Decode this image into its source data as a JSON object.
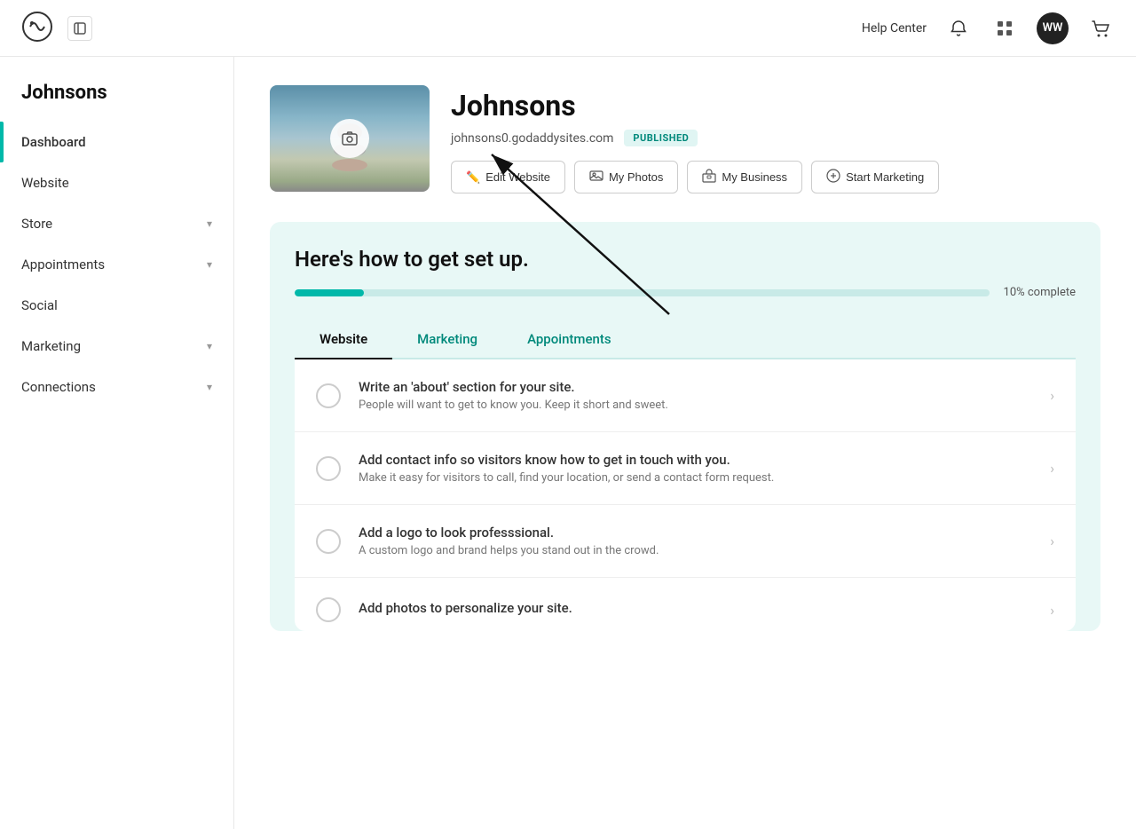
{
  "header": {
    "help_center": "Help Center",
    "avatar_initials": "WW",
    "collapse_icon": "◀"
  },
  "sidebar": {
    "brand": "Johnsons",
    "nav_items": [
      {
        "id": "dashboard",
        "label": "Dashboard",
        "active": true,
        "has_chevron": false
      },
      {
        "id": "website",
        "label": "Website",
        "active": false,
        "has_chevron": false
      },
      {
        "id": "store",
        "label": "Store",
        "active": false,
        "has_chevron": true
      },
      {
        "id": "appointments",
        "label": "Appointments",
        "active": false,
        "has_chevron": true
      },
      {
        "id": "social",
        "label": "Social",
        "active": false,
        "has_chevron": false
      },
      {
        "id": "marketing",
        "label": "Marketing",
        "active": false,
        "has_chevron": true
      },
      {
        "id": "connections",
        "label": "Connections",
        "active": false,
        "has_chevron": true
      }
    ]
  },
  "profile": {
    "name": "Johnsons",
    "url": "johnsons0.godaddysites.com",
    "status": "PUBLISHED",
    "actions": [
      {
        "id": "edit-website",
        "label": "Edit Website",
        "icon": "✏️"
      },
      {
        "id": "my-photos",
        "label": "My Photos",
        "icon": "🖼"
      },
      {
        "id": "my-business",
        "label": "My Business",
        "icon": "🏪"
      },
      {
        "id": "start-marketing",
        "label": "Start Marketing",
        "icon": "➕"
      }
    ]
  },
  "setup": {
    "title": "Here's how to get set up.",
    "progress_percent": 10,
    "progress_label": "10% complete",
    "tabs": [
      {
        "id": "website",
        "label": "Website",
        "active": true
      },
      {
        "id": "marketing",
        "label": "Marketing",
        "active": false
      },
      {
        "id": "appointments",
        "label": "Appointments",
        "active": false
      }
    ],
    "checklist": [
      {
        "id": "about",
        "title": "Write an 'about' section for your site.",
        "desc": "People will want to get to know you. Keep it short and sweet."
      },
      {
        "id": "contact",
        "title": "Add contact info so visitors know how to get in touch with you.",
        "desc": "Make it easy for visitors to call, find your location, or send a contact form request."
      },
      {
        "id": "logo",
        "title": "Add a logo to look professsional.",
        "desc": "A custom logo and brand helps you stand out in the crowd."
      },
      {
        "id": "photos",
        "title": "Add photos to personalize your site.",
        "desc": ""
      }
    ]
  }
}
